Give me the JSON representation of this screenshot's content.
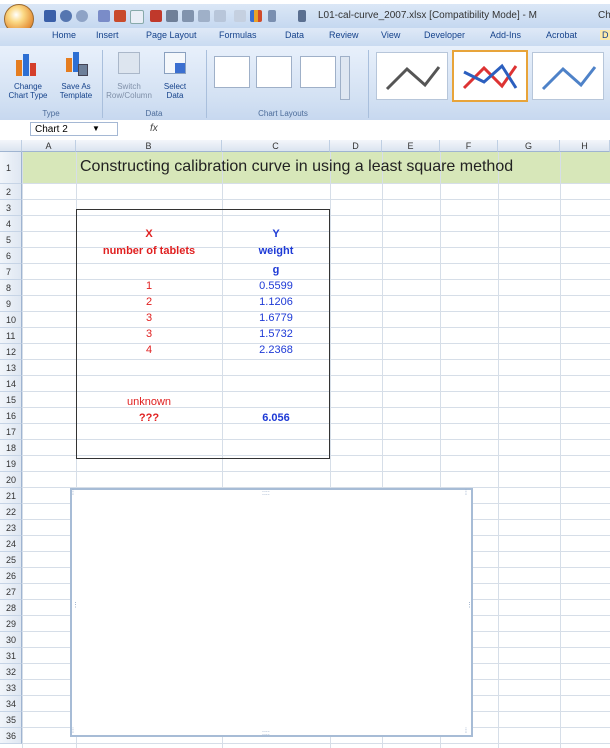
{
  "window": {
    "title": "L01-cal-curve_2007.xlsx [Compatibility Mode] - M",
    "title_suffix": "Ch"
  },
  "tabs": [
    "Home",
    "Insert",
    "Page Layout",
    "Formulas",
    "Data",
    "Review",
    "View",
    "Developer",
    "Add-Ins",
    "Acrobat",
    "D"
  ],
  "ribbon": {
    "type_group": {
      "label": "Type",
      "change_chart_type": "Change\nChart Type",
      "save_as_template": "Save As\nTemplate"
    },
    "data_group": {
      "label": "Data",
      "switch_row_column": "Switch\nRow/Column",
      "select_data": "Select\nData"
    },
    "chart_layouts_group": {
      "label": "Chart Layouts"
    }
  },
  "formula_bar": {
    "name_box": "Chart 2",
    "fx": "fx"
  },
  "columns": [
    "A",
    "B",
    "C",
    "D",
    "E",
    "F",
    "G",
    "H"
  ],
  "rows": [
    "1",
    "2",
    "3",
    "4",
    "5",
    "6",
    "7",
    "8",
    "9",
    "10",
    "11",
    "12",
    "13",
    "14",
    "15",
    "16",
    "17",
    "18",
    "19",
    "20",
    "21",
    "22",
    "23",
    "24",
    "25",
    "26",
    "27",
    "28",
    "29",
    "30",
    "31",
    "32",
    "33",
    "34",
    "35",
    "36"
  ],
  "sheet": {
    "heading": "Constructing calibration curve in  using a least square method",
    "x_header": "X",
    "x_subheader": "number of tablets",
    "y_header": "Y",
    "y_subheader": "weight",
    "y_unit": "g",
    "x_values": [
      "1",
      "2",
      "3",
      "3",
      "4"
    ],
    "y_values": [
      "0.5599",
      "1.1206",
      "1.6779",
      "1.5732",
      "2.2368"
    ],
    "unknown_label": "unknown",
    "unknown_x": "???",
    "unknown_y": "6.056"
  },
  "colors": {
    "accent_red": "#e02020",
    "accent_blue": "#1e3ad6",
    "heading_band": "#d7e7b9"
  }
}
